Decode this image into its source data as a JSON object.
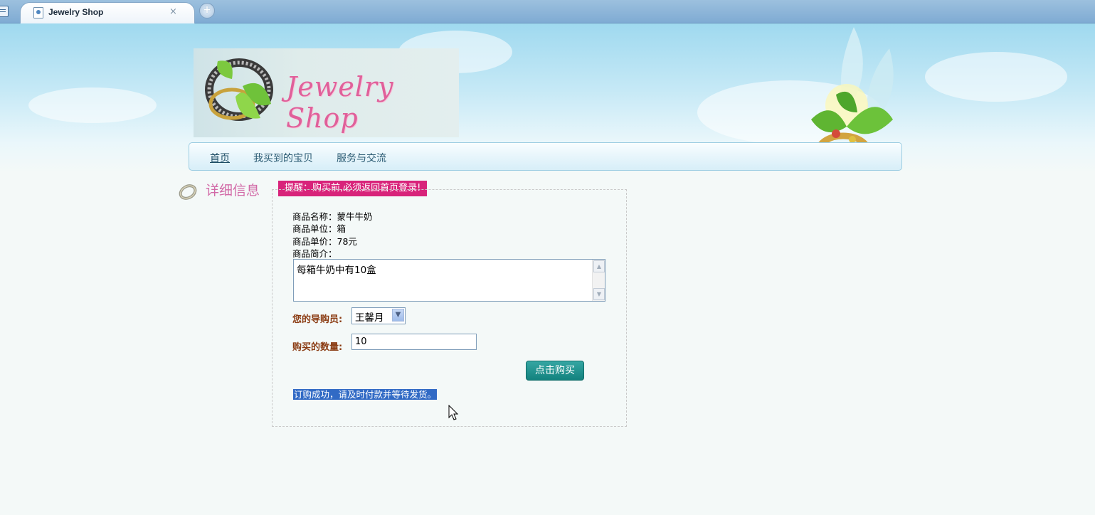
{
  "browser": {
    "tab_title": "Jewelry Shop",
    "tab_close": "×",
    "new_tab": "+"
  },
  "header": {
    "logo_text": "Jewelry Shop"
  },
  "nav": {
    "items": [
      {
        "label": "首页",
        "active": true
      },
      {
        "label": "我买到的宝贝",
        "active": false
      },
      {
        "label": "服务与交流",
        "active": false
      }
    ]
  },
  "detail": {
    "section_title": "详细信息",
    "notice": "提醒：购买前,必须返回首页登录!",
    "product_name": "商品名称：蒙牛牛奶",
    "product_unit": "商品单位：箱",
    "product_price": "商品单价：78元",
    "product_intro_label": "商品简介：",
    "product_intro": "每箱牛奶中有10盒",
    "guide_label": "您的导购员:",
    "guide_selected": "王馨月",
    "quantity_label": "购买的数量:",
    "quantity_value": "10",
    "buy_button": "点击购买",
    "success_message": "订购成功，请及时付款并等待发货。"
  },
  "colors": {
    "notice_bg": "#d8237a",
    "button_bg": "#13827e",
    "title_pink": "#d26aa7",
    "label_brown": "#8a3b12",
    "selection_blue": "#316ac5"
  }
}
